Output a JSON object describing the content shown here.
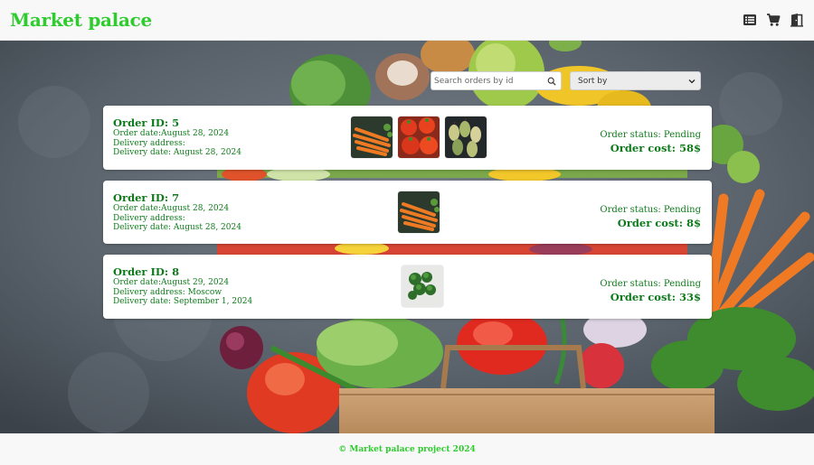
{
  "header": {
    "brand": "Market palace",
    "icons": [
      "orders-list-icon",
      "cart-icon",
      "logout-door-icon"
    ]
  },
  "search": {
    "placeholder": "Search orders by id",
    "value": ""
  },
  "sort": {
    "selected": "Sort by"
  },
  "orders": [
    {
      "id_label": "Order ID: 5",
      "order_date": "Order date:August 28, 2024",
      "delivery_address": "Delivery address:",
      "delivery_date": "Delivery date: August 28, 2024",
      "status": "Order status: Pending",
      "cost": "Order cost: 58$",
      "items": [
        "carrots",
        "tomatoes",
        "pears"
      ]
    },
    {
      "id_label": "Order ID: 7",
      "order_date": "Order date:August 28, 2024",
      "delivery_address": "Delivery address:",
      "delivery_date": "Delivery date: August 28, 2024",
      "status": "Order status: Pending",
      "cost": "Order cost: 8$",
      "items": [
        "carrots"
      ]
    },
    {
      "id_label": "Order ID: 8",
      "order_date": "Order date:August 29, 2024",
      "delivery_address": "Delivery address: Moscow",
      "delivery_date": "Delivery date: September 1, 2024",
      "status": "Order status: Pending",
      "cost": "Order cost: 33$",
      "items": [
        "broccoli"
      ]
    }
  ],
  "footer": {
    "text": "© Market palace project 2024"
  },
  "colors": {
    "brand": "#2ecc2e",
    "order_text": "#0f7a1b",
    "card_bg": "#ffffff",
    "icon": "#333333"
  }
}
